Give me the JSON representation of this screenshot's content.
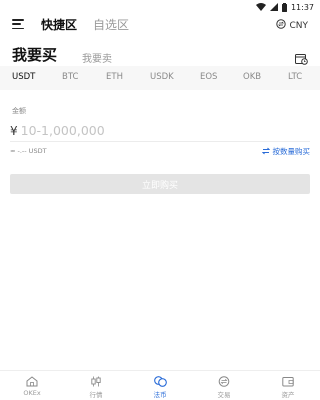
{
  "status_bar": {
    "time": "11:37"
  },
  "header": {
    "tab_quick": "快捷区",
    "tab_custom": "自选区",
    "currency": "CNY"
  },
  "trade": {
    "buy_tab": "我要买",
    "sell_tab": "我要卖"
  },
  "coins": [
    "USDT",
    "BTC",
    "ETH",
    "USDK",
    "EOS",
    "OKB",
    "LTC"
  ],
  "selected_coin": "USDT",
  "amount": {
    "label": "金额",
    "currency_symbol": "¥",
    "placeholder": "10-1,000,000",
    "approx_text": "≈ -.-- USDT",
    "by_quantity_link": "按数量购买"
  },
  "buy_button": "立即购买",
  "bottom_nav": [
    {
      "label": "OKEx",
      "icon": "home-icon"
    },
    {
      "label": "行情",
      "icon": "candlestick-icon"
    },
    {
      "label": "法币",
      "icon": "coins-icon",
      "active": true
    },
    {
      "label": "交易",
      "icon": "exchange-icon"
    },
    {
      "label": "资产",
      "icon": "wallet-icon"
    }
  ],
  "colors": {
    "accent": "#2a6cd8",
    "inactive": "#999999",
    "button_disabled": "#e4e4e4"
  }
}
